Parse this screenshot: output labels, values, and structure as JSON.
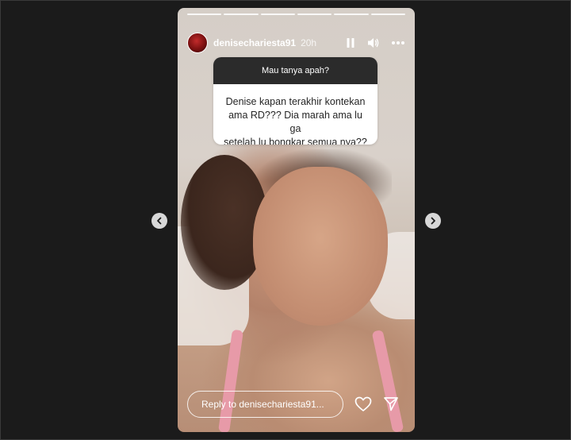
{
  "story": {
    "username": "denisechariesta91",
    "time_ago": "20h",
    "progress_segments": 6
  },
  "question_sticker": {
    "prompt": "Mau tanya apah?",
    "answer": "Denise kapan terakhir kontekan\nama RD??? Dia marah ama lu ga\nsetelah lu  bongkar semua nya??"
  },
  "reply": {
    "placeholder": "Reply to denisechariesta91..."
  },
  "icons": {
    "pause": "pause-icon",
    "volume": "volume-icon",
    "more": "more-icon",
    "heart": "heart-icon",
    "send": "send-icon",
    "prev": "chevron-left-icon",
    "next": "chevron-right-icon"
  }
}
